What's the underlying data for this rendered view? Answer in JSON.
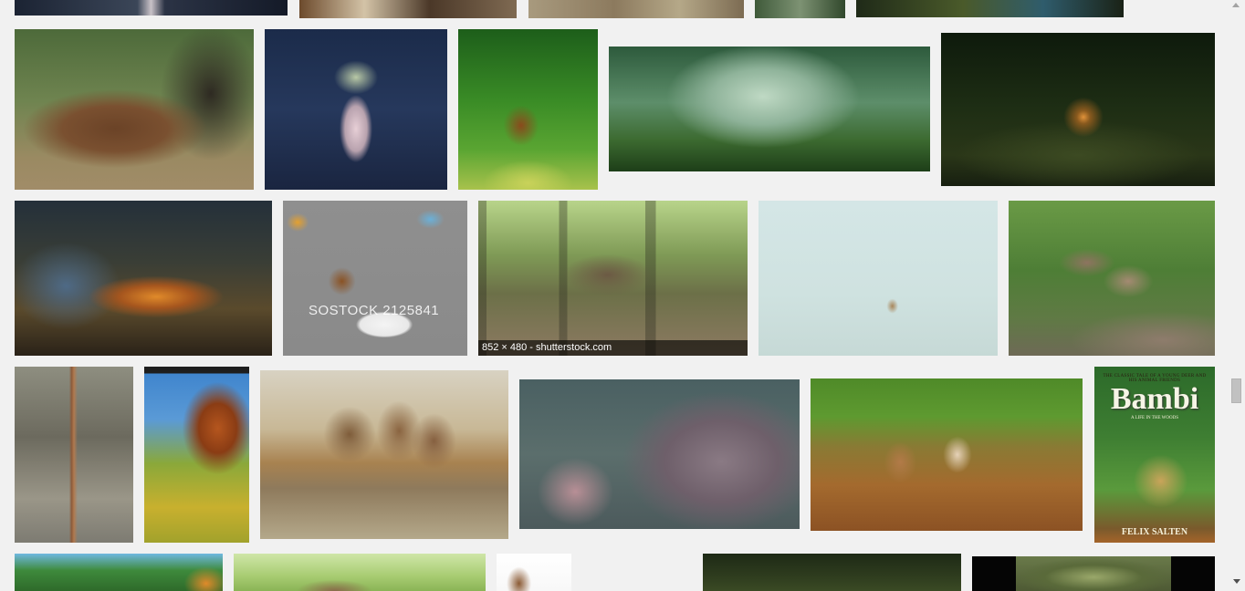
{
  "results": {
    "hover_caption": "852 × 480 - shutterstock.com",
    "watermark_text": "SOSTOCK 2125841",
    "book": {
      "tagline": "THE CLASSIC TALE OF A YOUNG DEER AND HIS ANIMAL FRIENDS",
      "title": "Bambi",
      "subtitle": "A LIFE IN THE WOODS",
      "author": "FELIX SALTEN"
    }
  },
  "colors": {
    "page_background": "#f1f1f1",
    "scrollbar_thumb": "#c1c1c1"
  }
}
